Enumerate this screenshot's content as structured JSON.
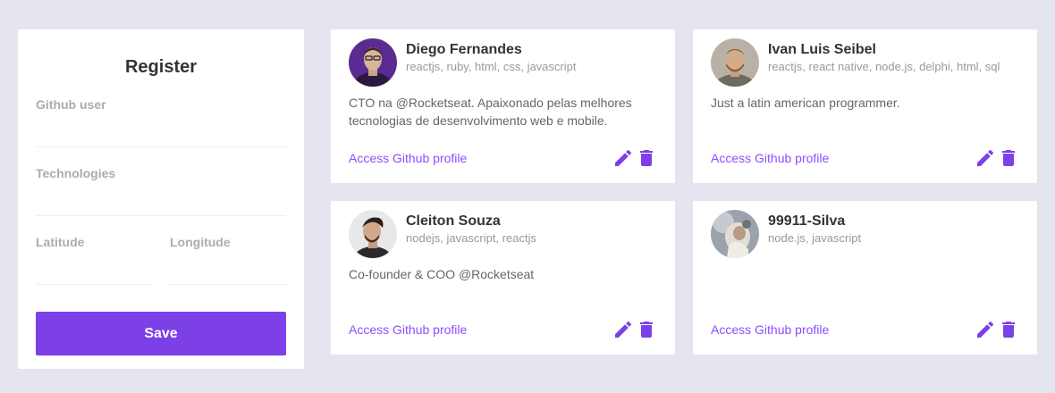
{
  "form": {
    "title": "Register",
    "github_user_label": "Github user",
    "github_user_value": "",
    "techs_label": "Technologies",
    "techs_value": "",
    "latitude_label": "Latitude",
    "latitude_value": "",
    "longitude_label": "Longitude",
    "longitude_value": "",
    "save_label": "Save"
  },
  "devs": [
    {
      "name": "Diego Fernandes",
      "techs": "reactjs, ruby, html, css, javascript",
      "bio": "CTO na @Rocketseat. Apaixonado pelas melhores tecnologias de desenvolvimento web e mobile.",
      "link": "Access Github profile"
    },
    {
      "name": "Ivan Luis Seibel",
      "techs": "reactjs, react native, node.js, delphi, html, sql",
      "bio": "Just a latin american programmer.",
      "link": "Access Github profile"
    },
    {
      "name": "Cleiton Souza",
      "techs": "nodejs, javascript, reactjs",
      "bio": "Co-founder & COO @Rocketseat",
      "link": "Access Github profile"
    },
    {
      "name": "99911-Silva",
      "techs": "node.js, javascript",
      "bio": "",
      "link": "Access Github profile"
    }
  ],
  "icons": {
    "edit": "pencil-icon",
    "delete": "trash-icon"
  },
  "colors": {
    "background": "#e5e5f0",
    "accent": "#7d40e7",
    "link": "#8e4dff",
    "card": "#ffffff"
  }
}
